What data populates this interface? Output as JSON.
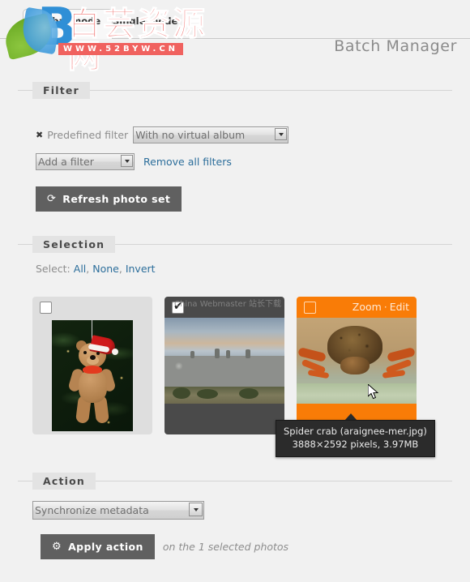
{
  "tabs": [
    {
      "label": "Global mode",
      "active": true
    },
    {
      "label": "Single mode",
      "active": false
    }
  ],
  "header": {
    "title": "Batch Manager"
  },
  "filter": {
    "legend": "Filter",
    "delete_icon": "✖",
    "predefined_label": "Predefined filter",
    "predefined_value": "With no virtual album",
    "add_filter_value": "Add a filter",
    "remove_all_label": "Remove all filters",
    "refresh_icon": "⟳",
    "refresh_label": "Refresh photo set"
  },
  "selection": {
    "legend": "Selection",
    "select_label": "Select:",
    "all_label": "All",
    "none_label": "None",
    "invert_label": "Invert",
    "comma": ",",
    "thumbnails": [
      {
        "name": "christmas-teddy-bear",
        "checked": false,
        "state": "unselected",
        "links": []
      },
      {
        "name": "stone-cairns",
        "checked": true,
        "state": "selected",
        "links": []
      },
      {
        "name": "spider-crab",
        "checked": false,
        "state": "hovered",
        "links": [
          "Zoom",
          "Edit"
        ],
        "link_separator": "·"
      }
    ]
  },
  "tooltip": {
    "title": "Spider crab (araignee-mer.jpg)",
    "details": "3888×2592 pixels, 3.97MB"
  },
  "action": {
    "legend": "Action",
    "selected_action": "Synchronize metadata",
    "apply_icon": "⚙",
    "apply_label": "Apply action",
    "apply_note": "on the 1 selected photos"
  },
  "watermark": {
    "logo_letter": "B",
    "text_cn": "白芸资源网",
    "url": "WWW.52BYW.CN",
    "thumb_overlay": "China Webmaster 站长下载"
  },
  "colors": {
    "accent_orange": "#f97c07",
    "link_blue": "#2c6e9b",
    "button_gray": "#606060",
    "selected_thumb": "#4a4a4a",
    "watermark_red": "#f0625f",
    "watermark_blue": "#2f8fd6"
  }
}
